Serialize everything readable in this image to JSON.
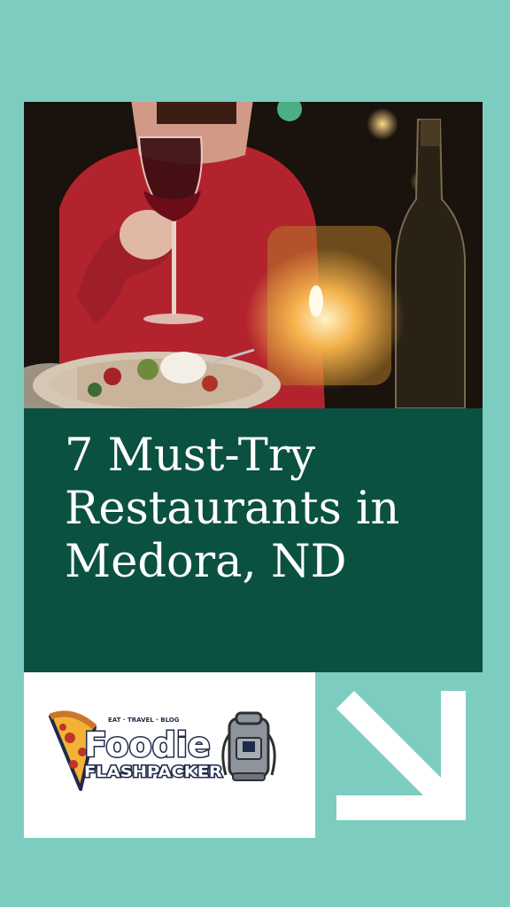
{
  "title": "7 Must-Try Restaurants in Medora, ND",
  "logo": {
    "tagline": "EAT · TRAVEL · BLOG",
    "name_top": "Foodie",
    "name_bottom": "FLASHPACKER"
  },
  "icons": {
    "arrow": "arrow-down-right-icon",
    "pizza": "pizza-slice-icon",
    "backpack": "backpack-icon"
  },
  "colors": {
    "background": "#7ccdc0",
    "title_block": "#0a5141",
    "title_text": "#ffffff",
    "card": "#ffffff",
    "logo_navy": "#1f2a4a"
  }
}
